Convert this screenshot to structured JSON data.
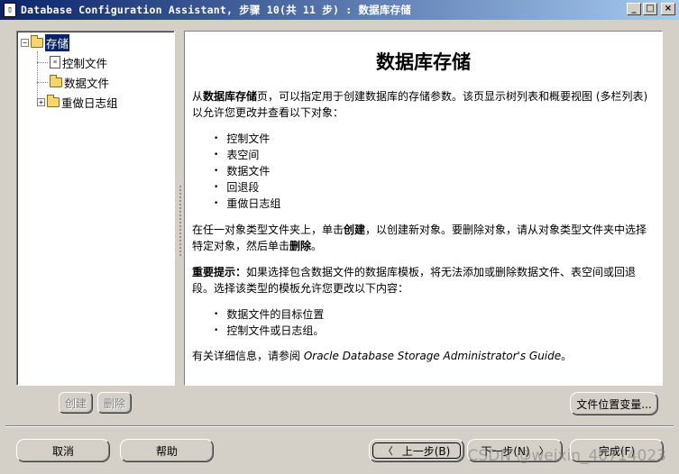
{
  "window": {
    "icon_label": "▯",
    "title": "Database Configuration Assistant, 步骤 10(共 11 步) : 数据库存储",
    "buttons": {
      "minimize": "_",
      "maximize": "□",
      "close": "×"
    }
  },
  "tree": {
    "root": {
      "label": "存储",
      "expander": "−"
    },
    "items": [
      {
        "label": "控制文件",
        "icon": "control-file-icon"
      },
      {
        "label": "数据文件",
        "icon": "folder-icon"
      },
      {
        "label": "重做日志组",
        "icon": "folder-icon",
        "expander": "+"
      }
    ]
  },
  "content": {
    "title": "数据库存储",
    "intro_prefix": "从",
    "intro_bold": "数据库存储",
    "intro_suffix": "页，可以指定用于创建数据库的存储参数。该页显示树列表和概要视图 (多栏列表) 以允许您更改并查看以下对象：",
    "objects": [
      "控制文件",
      "表空间",
      "数据文件",
      "回退段",
      "重做日志组"
    ],
    "create_p1": "在任一对象类型文件夹上，单击",
    "create_bold": "创建",
    "create_p2": "，以创建新对象。要删除对象，请从对象类型文件夹中选择特定对象，然后单击",
    "delete_bold": "删除",
    "create_p3": "。",
    "important_bold": "重要提示：",
    "important_text": "如果选择包含数据文件的数据库模板，将无法添加或删除数据文件、表空间或回退段。选择该类型的模板允许您更改以下内容：",
    "allowed": [
      "数据文件的目标位置",
      "控制文件或日志组。"
    ],
    "more_prefix": "有关详细信息，请参阅 ",
    "more_italic": "Oracle Database Storage Administrator's Guide",
    "more_suffix": "。"
  },
  "buttons": {
    "create": "创建",
    "delete": "删除",
    "file_location": "文件位置变量...",
    "cancel": "取消",
    "help": "帮助",
    "back": "上一步(B)",
    "back_arrow": "〈",
    "next": "下一步(N)",
    "next_arrow": "〉",
    "finish": "完成(F)"
  },
  "watermark": "CSDN @weixin_40714023"
}
